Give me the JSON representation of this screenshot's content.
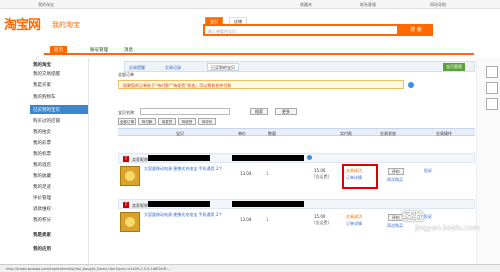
{
  "topbar": {
    "items": [
      "我的淘宝",
      "收藏夹",
      "联系客服",
      "网站导航"
    ],
    "greeting": "..."
  },
  "header": {
    "logo": "淘宝网",
    "logo_sub": "我的淘宝",
    "search_tabs": [
      "宝贝",
      "店铺"
    ],
    "search_placeholder": "输入想要的宝贝",
    "search_button": "搜 索"
  },
  "nav": {
    "items": [
      "首页",
      "账号管理",
      "消息"
    ]
  },
  "sidebar": {
    "items": [
      "我的淘宝",
      "我的交易提醒",
      "我是买家",
      "我的购物车",
      "已买到的宝贝",
      "购买过的店铺",
      "我的拍卖",
      "我的彩票",
      "我的机票",
      "我的酒店",
      "我的收藏",
      "我的足迹",
      "评价管理",
      "退款维权",
      "我的积分",
      "我是卖家",
      "我的应用"
    ],
    "highlight_index": 4
  },
  "breadcrumb": {
    "items": [
      "交易提醒",
      "交易记录",
      "已买到的宝贝"
    ],
    "right_button": "宝贝管理"
  },
  "hint": {
    "label": "全部订单",
    "text": "如果您的订单处于“待付款”“待发货”状态，可以将其合并付款"
  },
  "filters": {
    "title_label": "宝贝名称:",
    "search_btn": "搜索",
    "more_btn": "更多"
  },
  "table": {
    "columns": [
      "宝贝",
      "单价",
      "数量",
      "实付款",
      "交易状态",
      "交易操作"
    ],
    "tabs": [
      "全部订单",
      "待付款",
      "待发货",
      "待收货",
      "待评价"
    ]
  },
  "orders": [
    {
      "shop": "卖家昵称",
      "title": "大容量移动电源 便携式充电宝 手机通用 2个",
      "price": "13.04",
      "qty": "1",
      "total": "15.00",
      "total_sub": "(含运费)",
      "status": "交易成功",
      "status_sub": "订单详情",
      "action": "评价",
      "action_sub": "再次购买",
      "complain": "投诉"
    },
    {
      "shop": "卖家昵称",
      "title": "大容量移动电源 便携式充电宝 手机通用 2个",
      "price": "13.04",
      "qty": "1",
      "total": "15.00",
      "total_sub": "(含运费)",
      "status": "交易成功",
      "status_sub": "订单详情",
      "action": "评价",
      "action_sub": "再次购买",
      "complain": "投诉"
    }
  ],
  "watermark": {
    "line1": "经验",
    "line2": "jingyan.baidu.com"
  },
  "statusbar": {
    "url": "http://trade.taobao.com/trade/itemlist/list_bought_items.htm?spm=a1z09.2.0.0.1d8f2e3f..."
  }
}
